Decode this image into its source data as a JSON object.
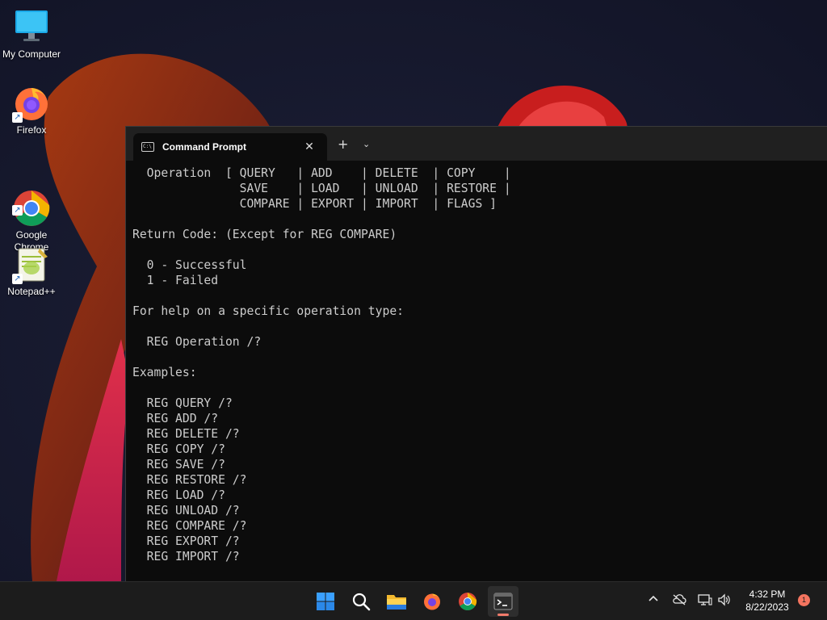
{
  "desktop": {
    "icons": [
      {
        "label": "My Computer"
      },
      {
        "label": "Firefox"
      },
      {
        "label": "Google\nChrome"
      },
      {
        "label": "Notepad++"
      }
    ]
  },
  "terminal": {
    "tab_title": "Command Prompt",
    "new_tab_label": "+",
    "dropdown_icon": "chevron-down-icon",
    "close_icon": "close-icon",
    "output": "  Operation  [ QUERY   | ADD    | DELETE  | COPY    |\n               SAVE    | LOAD   | UNLOAD  | RESTORE |\n               COMPARE | EXPORT | IMPORT  | FLAGS ]\n\nReturn Code: (Except for REG COMPARE)\n\n  0 - Successful\n  1 - Failed\n\nFor help on a specific operation type:\n\n  REG Operation /?\n\nExamples:\n\n  REG QUERY /?\n  REG ADD /?\n  REG DELETE /?\n  REG COPY /?\n  REG SAVE /?\n  REG RESTORE /?\n  REG LOAD /?\n  REG UNLOAD /?\n  REG COMPARE /?\n  REG EXPORT /?\n  REG IMPORT /?"
  },
  "taskbar": {
    "apps": [
      "windows-start-icon",
      "search-icon",
      "file-explorer-icon",
      "firefox-icon",
      "chrome-icon",
      "terminal-icon"
    ],
    "tray": [
      "chevron-up-icon",
      "cloud-offline-icon",
      "network-icon",
      "volume-icon"
    ],
    "time": "4:32 PM",
    "date": "8/22/2023",
    "notification_count": "1",
    "accent_color": "#f07b6b"
  }
}
